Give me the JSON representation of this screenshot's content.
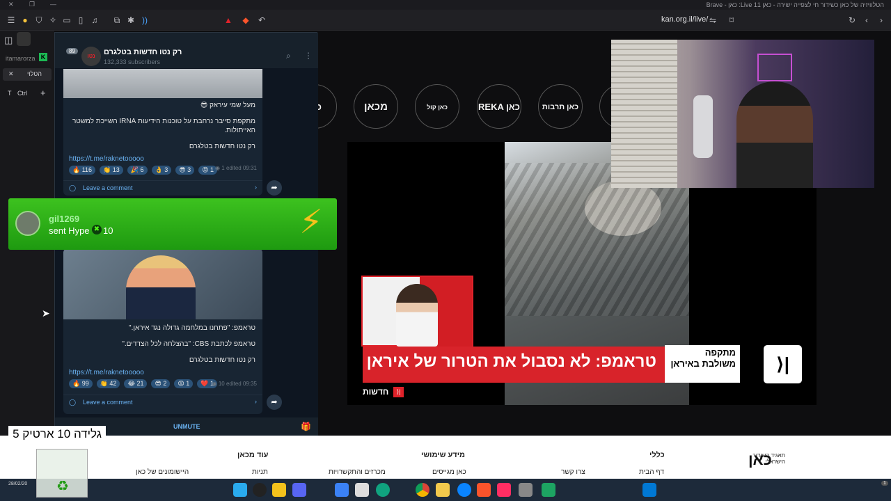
{
  "browser": {
    "window_title": "הטלוויזיה של כאן כשידור חי לצפייה ישירה - כאן 11 Live: כאן - Brave",
    "url": "kan.org.il/live/",
    "tab_label": "הטלוי",
    "profile_name": "itamarorza"
  },
  "sidebar": {
    "ctrl_label": "Ctrl",
    "t_label": "T"
  },
  "telegram": {
    "channel_name": "רק נטו חדשות בטלגרם",
    "subscribers": "132,333 subscribers",
    "unread_badge": "89",
    "post1": {
      "line1": "מעל שמי עיראק 😎",
      "line2": "מתקפת סייבר נרחבת על טוכנות הידיעות IRNA השייכת למשטר האייתולות.",
      "line3": "רק נטו חדשות בטלגרם",
      "link": "https://t.me/raknetooooo",
      "reactions": [
        "🔥 116",
        "👏 13",
        "🎉 6",
        "👌 3",
        "😎 3",
        "😡 1"
      ],
      "views": "1",
      "edited": "edited 09:31",
      "comment": "Leave a comment"
    },
    "post2": {
      "line1": "טראמפ: \"פתחנו במלחמה גדולה נגד איראן.\"",
      "line2": "טראמפ לכתבת CBS: \"בהצלחה לכל הצדדים.\"",
      "line3": "רק נטו חדשות בטלגרם",
      "link": "https://t.me/raknetooooo",
      "reactions": [
        "🔥 99",
        "👏 42",
        "😂 21",
        "😎 2",
        "😡 1",
        "❤️ 1"
      ],
      "views": "10",
      "edited": "edited 09:35",
      "comment": "Leave a comment"
    },
    "unmute": "UNMUTE"
  },
  "hype": {
    "user": "gil1269",
    "action": "sent Hype",
    "amount": "10"
  },
  "overlay": {
    "gift_text": "גלידה 10 ארטיק 5"
  },
  "kan": {
    "channels": [
      "כאן",
      "מכאן",
      "כאן קול המוזיקה",
      "REKA כאן",
      "כאן תרבות"
    ],
    "headline": "טראמפ: לא נסבול את הטרור של איראן",
    "side_tag": "מתקפה משולבת באיראן",
    "news_label": "חדשות",
    "logo": "כאן",
    "logo_sub": "תאגיד השידור הישראלי"
  },
  "footer": {
    "cols": [
      {
        "head": "כללי",
        "item": "דף הבית"
      },
      {
        "head": "",
        "item": "צרו קשר"
      },
      {
        "head": "מידע שימושי",
        "item": "כאן מגייסים"
      },
      {
        "head": "",
        "item": "מכרזים והתקשרויות"
      },
      {
        "head": "עוד מכאן",
        "item": "תניות"
      },
      {
        "head": "",
        "item": "היישומונים של כאן"
      }
    ]
  },
  "taskbar": {
    "date": "28/02/20",
    "badge": "1"
  },
  "colors": {
    "hype_green": "#2db41a",
    "kan_red": "#e0222a",
    "tg_link": "#6ab2f2"
  }
}
